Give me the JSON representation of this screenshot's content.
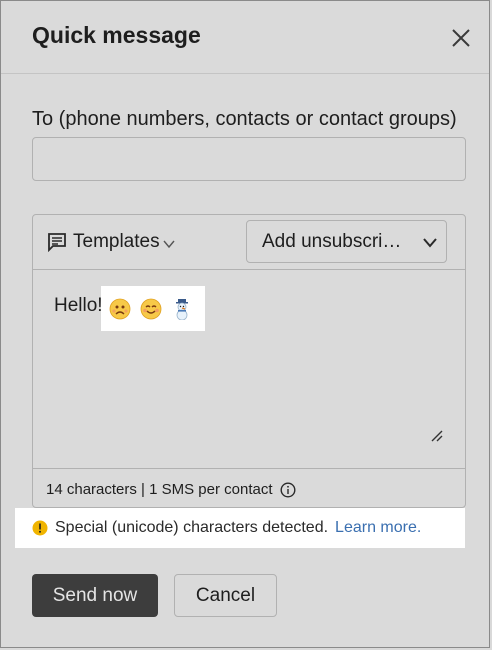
{
  "dialog": {
    "title": "Quick message",
    "close_icon": "close-icon"
  },
  "recipients": {
    "label": "To (phone numbers, contacts or contact groups)",
    "value": "",
    "placeholder": ""
  },
  "toolbar": {
    "templates_label": "Templates",
    "templates_icon": "message-template-icon",
    "unsubscribe_label": "Add unsubscri…"
  },
  "message": {
    "text": "Hello!",
    "emojis": [
      "frowning-face-icon",
      "smiling-face-icon",
      "snowman-icon"
    ]
  },
  "counter": {
    "text": "14 characters | 1 SMS per contact",
    "icon": "info-icon"
  },
  "notice": {
    "text": "Special (unicode) characters detected.",
    "link": "Learn more.",
    "icon": "warning-icon",
    "icon_color": "#f0b400"
  },
  "actions": {
    "send_label": "Send now",
    "cancel_label": "Cancel"
  },
  "colors": {
    "primary_button": "#3d3d3d",
    "link": "#3a6fb0"
  }
}
